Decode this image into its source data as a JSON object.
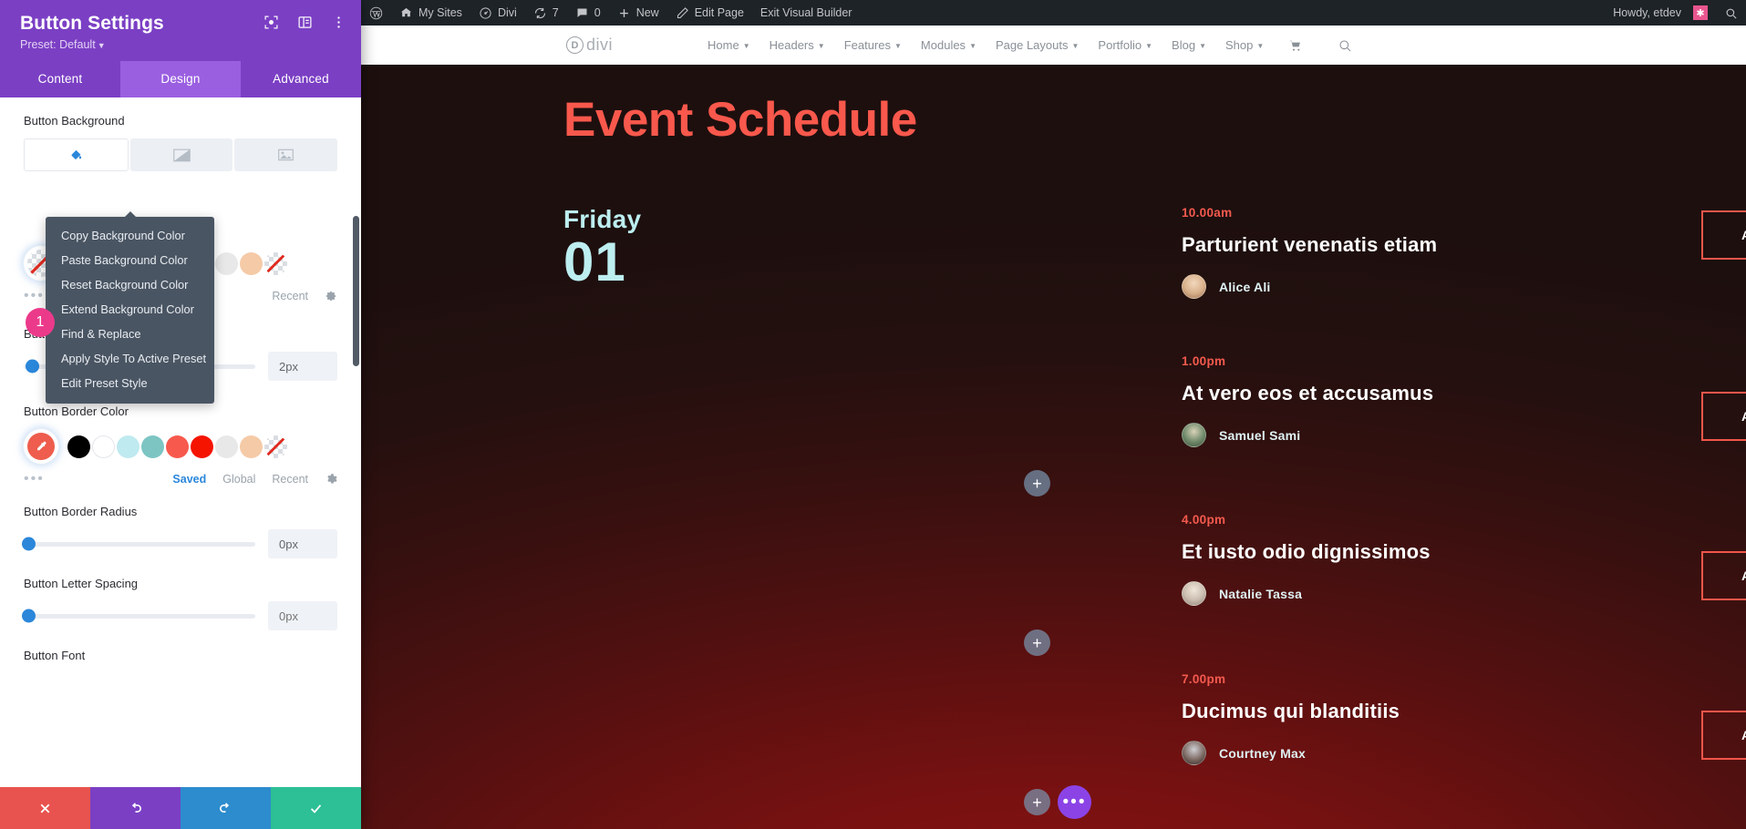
{
  "settings_panel": {
    "title": "Button Settings",
    "preset": "Preset: Default",
    "header_icons": [
      "target-icon",
      "layout-icon",
      "more-vertical-icon"
    ],
    "tabs": [
      {
        "label": "Content",
        "active": false
      },
      {
        "label": "Design",
        "active": true
      },
      {
        "label": "Advanced",
        "active": false
      }
    ],
    "button_background": {
      "label": "Button Background",
      "types": [
        "paint-bucket-icon",
        "gradient-icon",
        "image-icon"
      ],
      "active_type": 0
    },
    "button_border_width": {
      "label": "Button Border Width",
      "value": "2px"
    },
    "button_border_color": {
      "label": "Button Border Color",
      "active_color": "#ee5d4d",
      "swatches": [
        "#000000",
        "#ffffff",
        "#bfeaf0",
        "#7cc5c3",
        "#f8594d",
        "#f51400",
        "#e8e8e8",
        "#f5caa7",
        "none"
      ],
      "links": [
        {
          "label": "Saved",
          "active": true
        },
        {
          "label": "Global",
          "active": false
        },
        {
          "label": "Recent",
          "active": false
        }
      ],
      "gear": "gear-icon"
    },
    "hidden_swatch_row": {
      "swatches": [
        "#e8e8e8",
        "#f5caa7",
        "none"
      ],
      "links": [
        {
          "label": "Recent",
          "active": false
        }
      ],
      "gear": "gear-icon"
    },
    "button_border_radius": {
      "label": "Button Border Radius",
      "value": "0px"
    },
    "button_letter_spacing": {
      "label": "Button Letter Spacing",
      "value": "",
      "placeholder": "0px"
    },
    "button_font": {
      "label": "Button Font"
    },
    "actions": [
      {
        "name": "cancel",
        "icon": "close-icon"
      },
      {
        "name": "undo",
        "icon": "undo-icon"
      },
      {
        "name": "redo",
        "icon": "redo-icon"
      },
      {
        "name": "save",
        "icon": "check-icon"
      }
    ]
  },
  "context_menu": {
    "items": [
      "Copy Background Color",
      "Paste Background Color",
      "Reset Background Color",
      "Extend Background Color",
      "Find & Replace",
      "Apply Style To Active Preset",
      "Edit Preset Style"
    ]
  },
  "step_badge": {
    "number": "1"
  },
  "admin_bar": {
    "left_items": [
      {
        "label": "",
        "icon": "wordpress-icon"
      },
      {
        "label": "My Sites",
        "icon": "sites-icon"
      },
      {
        "label": "Divi",
        "icon": "divi-icon"
      },
      {
        "label": "7",
        "icon": "updates-icon"
      },
      {
        "label": "0",
        "icon": "comments-icon"
      },
      {
        "label": "New",
        "icon": "plus-icon"
      },
      {
        "label": "Edit Page",
        "icon": "pencil-icon"
      },
      {
        "label": "Exit Visual Builder",
        "icon": ""
      }
    ],
    "howdy": "Howdy, etdev",
    "avatar_glyph": "✱",
    "search_icon": "search-icon"
  },
  "site_header": {
    "logo_mark": "D",
    "logo_text": "divi",
    "nav": [
      "Home",
      "Headers",
      "Features",
      "Modules",
      "Page Layouts",
      "Portfolio",
      "Blog",
      "Shop"
    ],
    "cart_icon": "cart-icon",
    "search_icon": "search-icon"
  },
  "page": {
    "title": "Event Schedule",
    "day": {
      "name": "Friday",
      "number": "01"
    },
    "events": [
      {
        "time": "10.00am",
        "title": "Parturient venenatis etiam",
        "speaker": "Alice Ali",
        "avatar_color": "#d8b08a",
        "button": "Add to Calendar"
      },
      {
        "time": "1.00pm",
        "title": "At vero eos et accusamus",
        "speaker": "Samuel Sami",
        "avatar_color": "#6f8a6a",
        "button": "Add to Calendar"
      },
      {
        "time": "4.00pm",
        "title": "Et iusto odio dignissimos",
        "speaker": "Natalie Tassa",
        "avatar_color": "#c9bcae",
        "button": "Add to Calendar"
      },
      {
        "time": "7.00pm",
        "title": "Ducimus qui blanditiis",
        "speaker": "Courtney Max",
        "avatar_color": "#7d6a63",
        "button": "Add to Calendar"
      }
    ],
    "add_module_label": "+",
    "module_actions_label": "•••",
    "accent_color": "#f9584c",
    "day_color": "#bdeef0"
  }
}
